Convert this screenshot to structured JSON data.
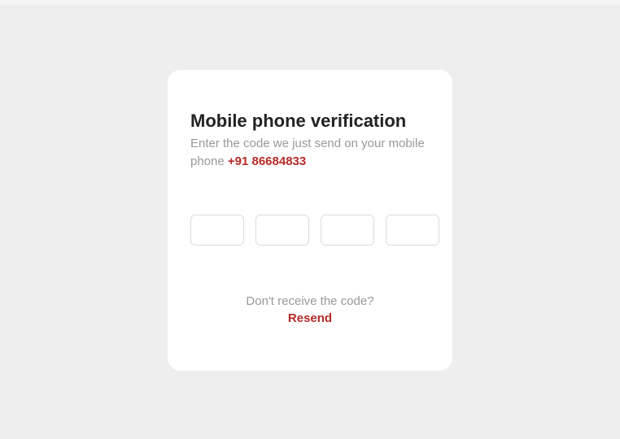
{
  "card": {
    "title": "Mobile phone verification",
    "subtitle_prefix": "Enter the code we just send on your mobile phone ",
    "phone": "+91 86684833",
    "noreceive": "Don't receive the code?",
    "resend": "Resend"
  },
  "inputs": {
    "d1": "",
    "d2": "",
    "d3": "",
    "d4": ""
  },
  "colors": {
    "accent": "#b52b27",
    "muted": "#999999",
    "background": "#eeeeee"
  }
}
